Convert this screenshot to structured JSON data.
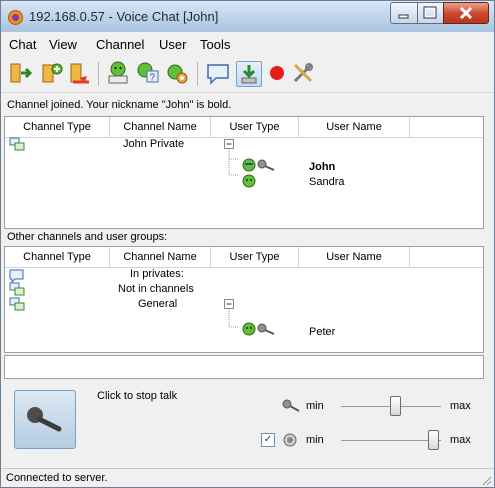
{
  "window": {
    "title": "192.168.0.57 - Voice Chat [John]"
  },
  "menu": [
    "Chat",
    "View",
    "Channel",
    "User",
    "Tools"
  ],
  "toolbar": {
    "icons": [
      "join-channel-icon",
      "create-channel-icon",
      "leave-channel-icon",
      "user-info-icon",
      "user-help-icon",
      "user-settings-icon",
      "message-icon",
      "download-icon",
      "record-icon",
      "tools-icon"
    ]
  },
  "status_line": "Channel joined. Your nickname \"John\" is bold.",
  "table_headers": [
    "Channel Type",
    "Channel Name",
    "User Type",
    "User Name"
  ],
  "joined": {
    "channel_name": "John Private",
    "users": [
      "John",
      "Sandra"
    ]
  },
  "other_label": "Other channels and user groups:",
  "others": {
    "rows": [
      "In privates:",
      "Not in channels",
      "General"
    ],
    "users": [
      "Peter"
    ]
  },
  "talk": {
    "label": "Click to stop talk"
  },
  "sliders": {
    "min": "min",
    "max": "max",
    "mic_level": 0.55,
    "volume_level": 0.98,
    "volume_checked": "✓"
  },
  "statusbar": "Connected to server."
}
